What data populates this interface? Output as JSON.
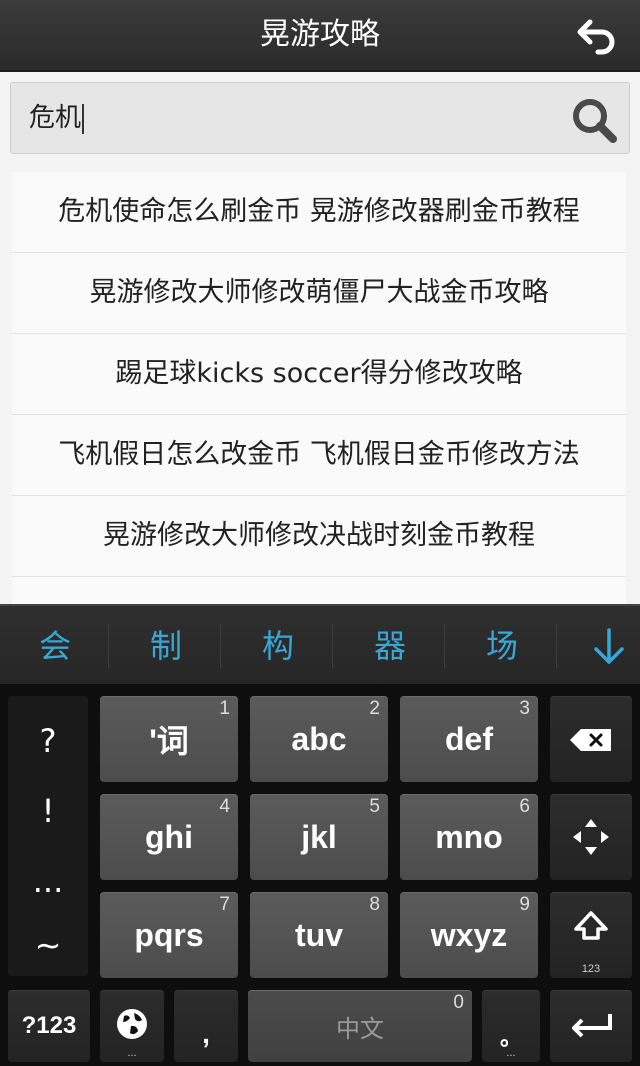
{
  "header": {
    "title": "晃游攻略",
    "back_icon": "undo-arrow-icon"
  },
  "search": {
    "value": "危机",
    "icon": "search-icon"
  },
  "suggestions": [
    "危机使命怎么刷金币 晃游修改器刷金币教程",
    "晃游修改大师修改萌僵尸大战金币攻略",
    "踢足球kicks soccer得分修改攻略",
    "飞机假日怎么改金币 飞机假日金币修改方法",
    "晃游修改大师修改决战时刻金币教程"
  ],
  "keyboard": {
    "candidates": [
      "会",
      "制",
      "构",
      "器",
      "场"
    ],
    "candidate_color": "#39a7d6",
    "symbols": [
      "?",
      "!",
      "...",
      "~"
    ],
    "keys": [
      {
        "label": "'词",
        "num": "1"
      },
      {
        "label": "abc",
        "num": "2"
      },
      {
        "label": "def",
        "num": "3"
      },
      {
        "label": "ghi",
        "num": "4"
      },
      {
        "label": "jkl",
        "num": "5"
      },
      {
        "label": "mno",
        "num": "6"
      },
      {
        "label": "pqrs",
        "num": "7"
      },
      {
        "label": "tuv",
        "num": "8"
      },
      {
        "label": "wxyz",
        "num": "9"
      }
    ],
    "shift_sub": "123",
    "bottom": {
      "symbols_key": "?123",
      "globe_sub": "...",
      "comma": ",",
      "space_label": "中文",
      "space_num": "0",
      "period": "。",
      "period_sub": "..."
    }
  }
}
